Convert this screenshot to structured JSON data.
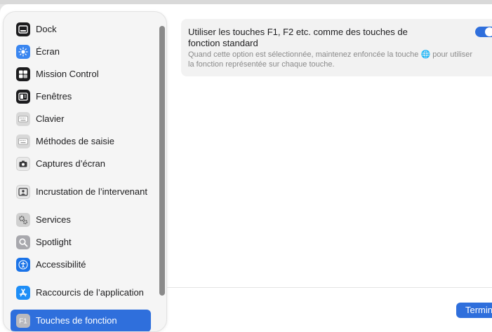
{
  "sidebar": {
    "items": [
      {
        "label": "Dock",
        "icon": "dock-icon"
      },
      {
        "label": "Écran",
        "icon": "display-icon"
      },
      {
        "label": "Mission Control",
        "icon": "mission-control-icon"
      },
      {
        "label": "Fenêtres",
        "icon": "windows-icon"
      },
      {
        "label": "Clavier",
        "icon": "keyboard-icon"
      },
      {
        "label": "Méthodes de saisie",
        "icon": "input-methods-icon"
      },
      {
        "label": "Captures d’écran",
        "icon": "screenshot-icon"
      },
      {
        "label": "Incrustation de l’intervenant",
        "icon": "presenter-overlay-icon"
      },
      {
        "label": "Services",
        "icon": "services-icon"
      },
      {
        "label": "Spotlight",
        "icon": "spotlight-icon"
      },
      {
        "label": "Accessibilité",
        "icon": "accessibility-icon"
      },
      {
        "label": "Raccourcis de l’application",
        "icon": "app-shortcuts-icon"
      },
      {
        "label": "Touches de fonction",
        "icon": "function-keys-icon",
        "selected": true
      }
    ]
  },
  "option": {
    "title": "Utiliser les touches F1, F2 etc. comme des touches de fonction standard",
    "description": "Quand cette option est sélectionnée, maintenez enfoncée la touche 🌐 pour utiliser la fonction représentée sur chaque touche.",
    "enabled": true
  },
  "footer": {
    "done_label": "Terminé"
  },
  "colors": {
    "accent": "#2f6fdc"
  }
}
